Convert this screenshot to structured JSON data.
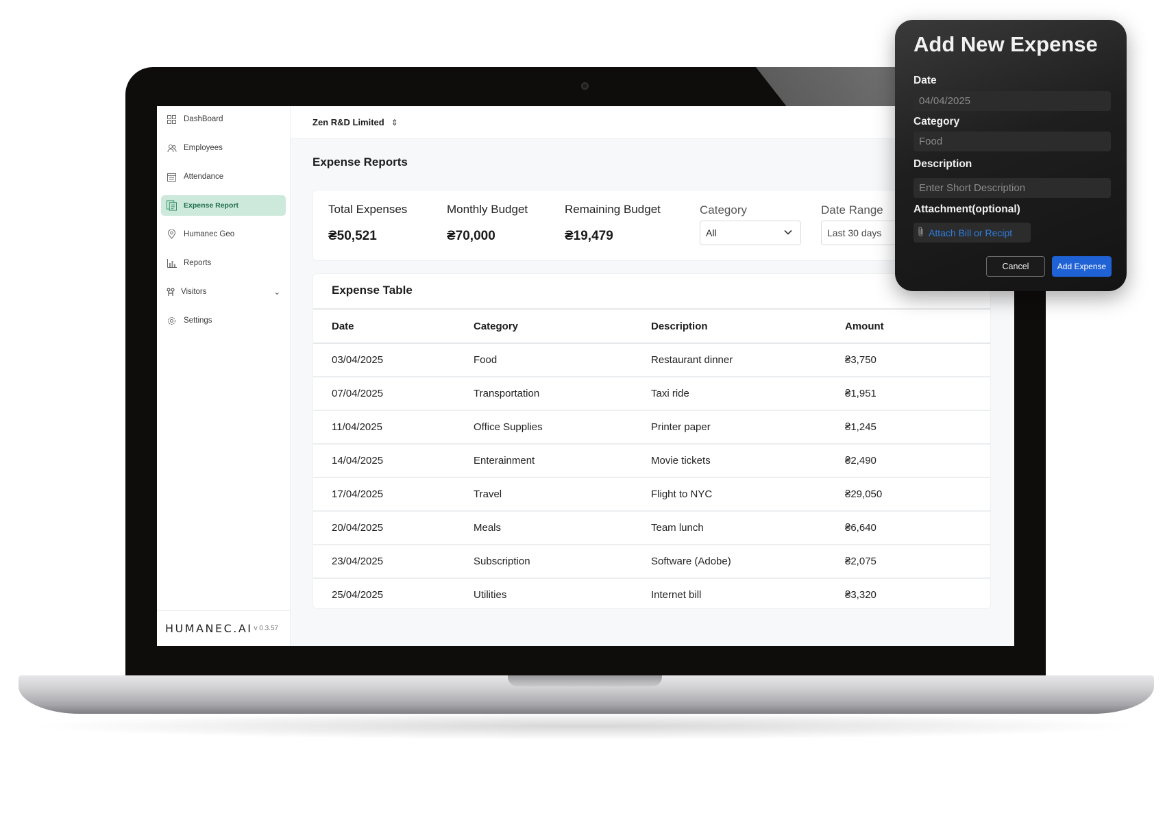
{
  "company": "Zen R&D Limited",
  "sidebar": {
    "items": [
      {
        "label": "DashBoard",
        "icon": "grid-icon"
      },
      {
        "label": "Employees",
        "icon": "users-icon"
      },
      {
        "label": "Attendance",
        "icon": "calendar-icon"
      },
      {
        "label": "Expense Report",
        "icon": "receipt-icon",
        "active": true
      },
      {
        "label": "Humanec Geo",
        "icon": "location-pin-icon"
      },
      {
        "label": "Reports",
        "icon": "bar-chart-icon"
      },
      {
        "label": "Visitors",
        "icon": "visitors-icon",
        "expandable": true
      },
      {
        "label": "Settings",
        "icon": "gear-icon"
      }
    ],
    "brand": "HUMANEC.AI",
    "version": "v 0.3.57"
  },
  "page_title": "Expense Reports",
  "summary": {
    "total_label": "Total Expenses",
    "total_value": "₴50,521",
    "budget_label": "Monthly Budget",
    "budget_value": "₴70,000",
    "remaining_label": "Remaining Budget",
    "remaining_value": "₴19,479",
    "category_label": "Category",
    "category_value": "All",
    "date_range_label": "Date Range",
    "date_range_value": "Last 30 days"
  },
  "table": {
    "title": "Expense Table",
    "headers": [
      "Date",
      "Category",
      "Description",
      "Amount"
    ],
    "rows": [
      [
        "03/04/2025",
        "Food",
        "Restaurant dinner",
        "₴3,750"
      ],
      [
        "07/04/2025",
        "Transportation",
        "Taxi ride",
        "₴1,951"
      ],
      [
        "11/04/2025",
        "Office Supplies",
        "Printer paper",
        "₴1,245"
      ],
      [
        "14/04/2025",
        "Enterainment",
        "Movie tickets",
        "₴2,490"
      ],
      [
        "17/04/2025",
        "Travel",
        "Flight to NYC",
        "₴29,050"
      ],
      [
        "20/04/2025",
        "Meals",
        "Team lunch",
        "₴6,640"
      ],
      [
        "23/04/2025",
        "Subscription",
        "Software (Adobe)",
        "₴2,075"
      ],
      [
        "25/04/2025",
        "Utilities",
        "Internet bill",
        "₴3,320"
      ]
    ]
  },
  "modal": {
    "title": "Add New Expense",
    "date_label": "Date",
    "date_value": "04/04/2025",
    "category_label": "Category",
    "category_value": "Food",
    "description_label": "Description",
    "description_placeholder": "Enter Short Description",
    "attachment_label": "Attachment(optional)",
    "attach_link": "Attach Bill or Recipt",
    "cancel_label": "Cancel",
    "add_label": "Add Expense"
  },
  "colors": {
    "active_nav_bg": "#cde9dc",
    "active_nav_text": "#1f6e4a",
    "primary_button": "#1f62d6",
    "link": "#2f7de1"
  }
}
